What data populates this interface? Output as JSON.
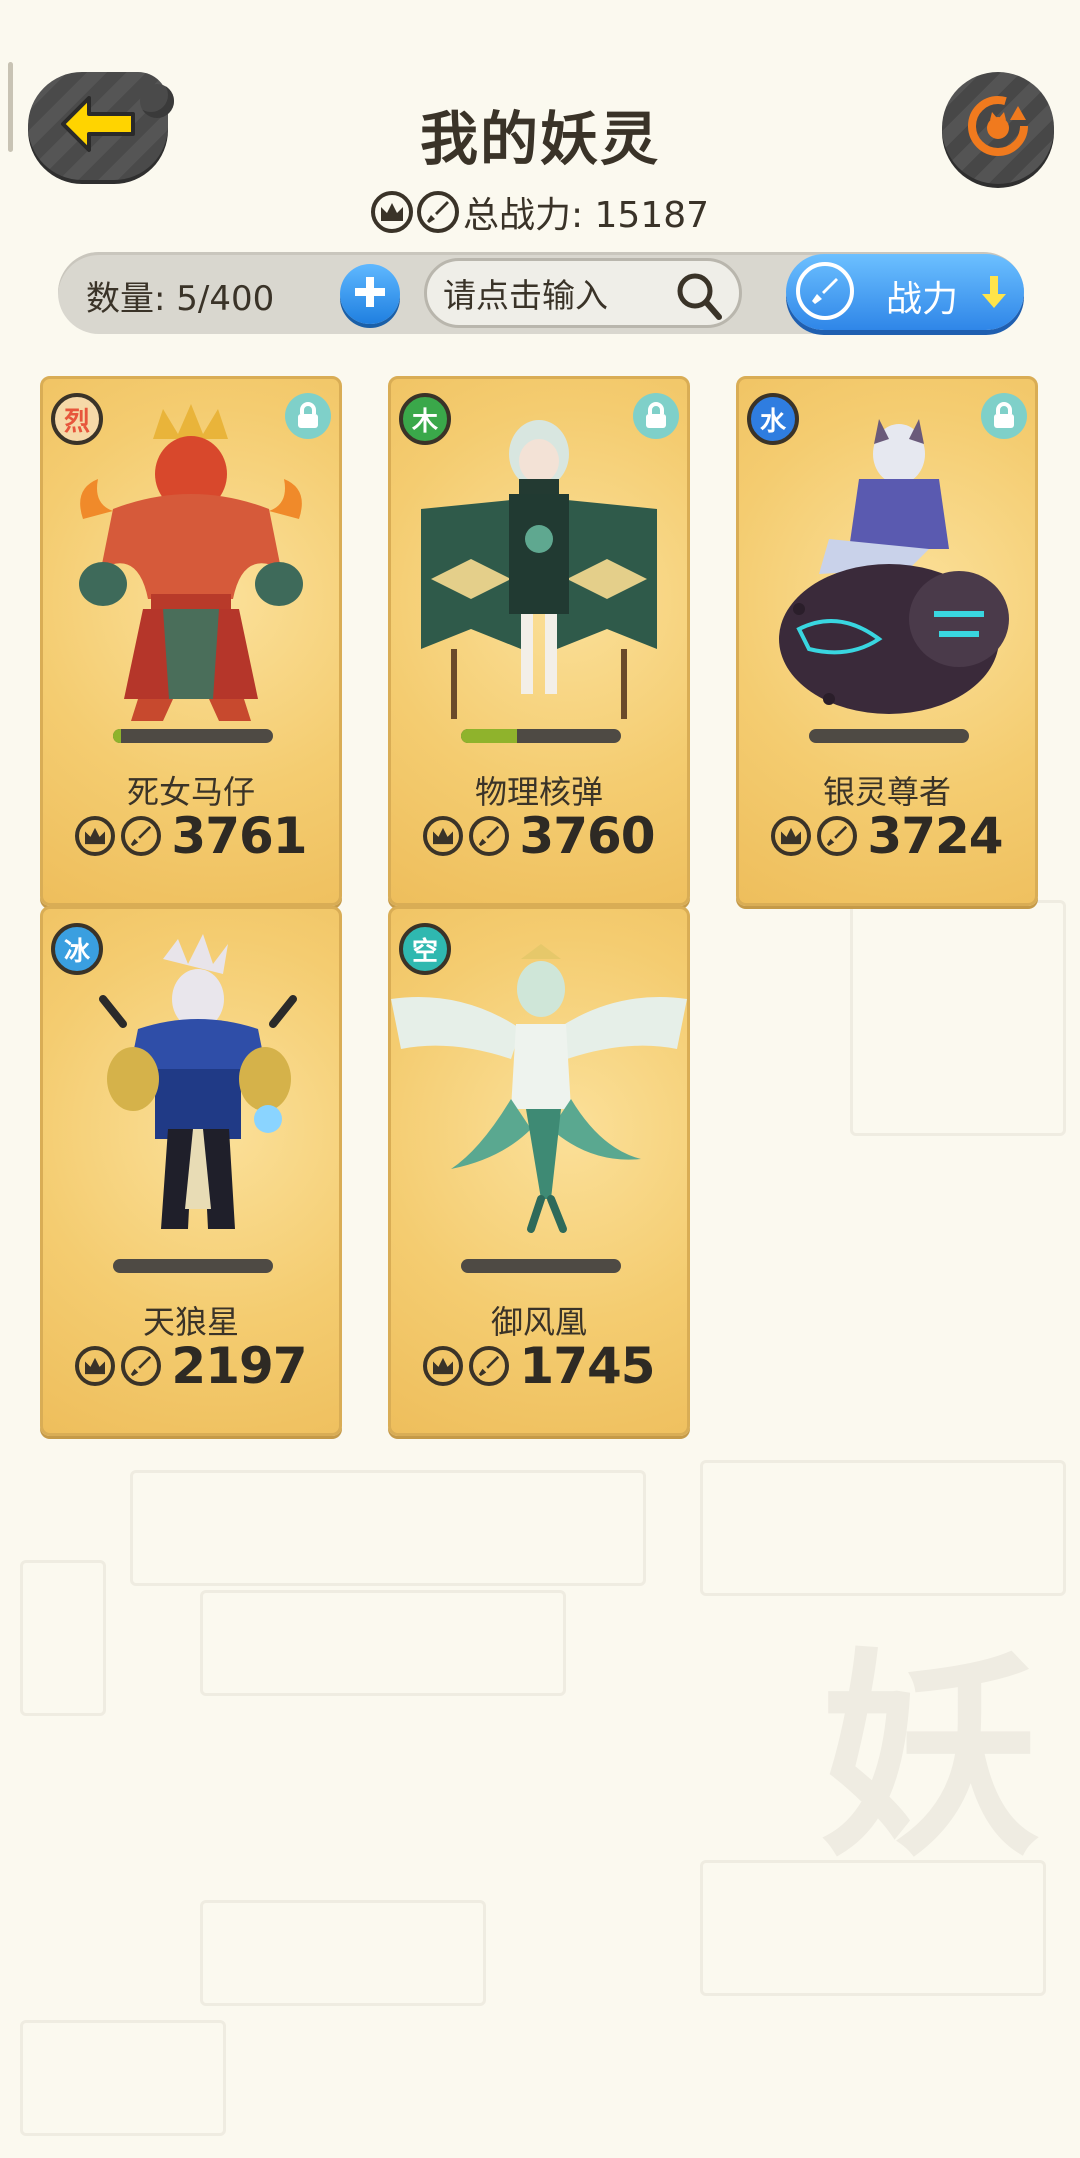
{
  "header": {
    "title": "我的妖灵",
    "total_power_label": "总战力: 15187"
  },
  "toolbar": {
    "count_label": "数量: 5/400",
    "search_placeholder": "请点击输入",
    "sort_label": "战力"
  },
  "colors": {
    "accent_blue": "#2f86e8",
    "card_gold": "#f4cc70",
    "dark_button": "#474747",
    "back_arrow": "#ffd400",
    "refresh_orange": "#f07a1e"
  },
  "cards": [
    {
      "name": "死女马仔",
      "power": "3761",
      "element": "烈",
      "element_color": "#e7563c",
      "level_fill_pct": 5,
      "locked": true
    },
    {
      "name": "物理核弹",
      "power": "3760",
      "element": "木",
      "element_color": "#3aa84a",
      "level_fill_pct": 35,
      "locked": true
    },
    {
      "name": "银灵尊者",
      "power": "3724",
      "element": "水",
      "element_color": "#2f7de0",
      "level_fill_pct": 0,
      "locked": true
    },
    {
      "name": "天狼星",
      "power": "2197",
      "element": "冰",
      "element_color": "#3a9fe0",
      "level_fill_pct": 0,
      "locked": false
    },
    {
      "name": "御风凰",
      "power": "1745",
      "element": "空",
      "element_color": "#2fb8b0",
      "level_fill_pct": 0,
      "locked": false
    }
  ]
}
